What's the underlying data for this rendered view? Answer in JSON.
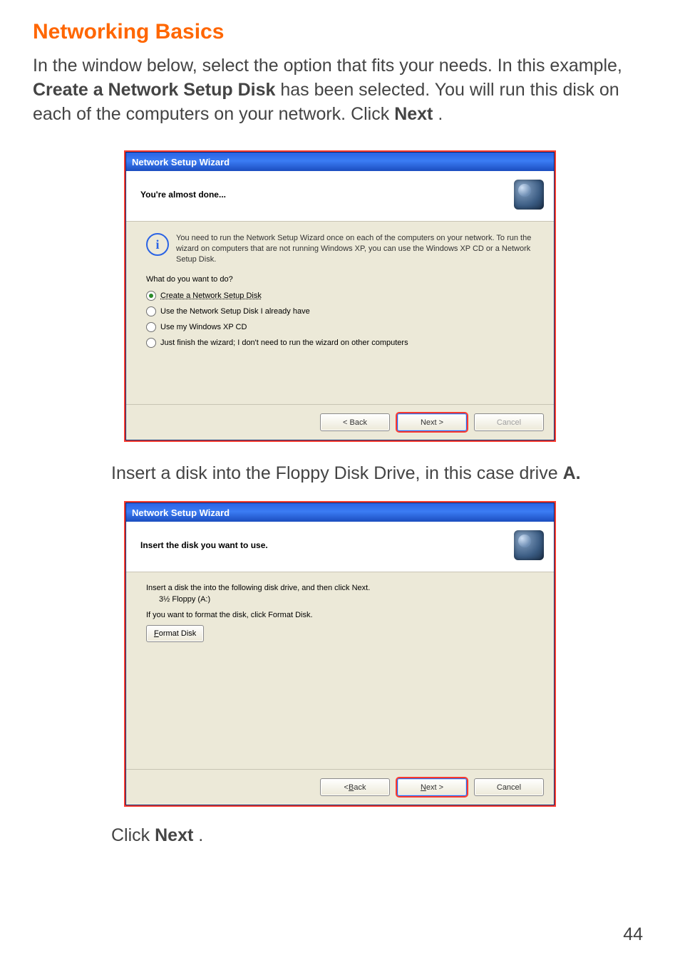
{
  "page": {
    "heading": "Networking Basics",
    "intro_prefix": "In the window below, select the option that fits your needs. In this example, ",
    "intro_bold1": "Create a Network Setup Disk",
    "intro_mid": " has been selected.  You will run this disk on each of the computers on your network. Click ",
    "intro_bold2": "Next",
    "intro_end": ".",
    "caption_prefix": "Insert a disk into the Floppy Disk Drive, in this case drive ",
    "caption_bold": "A.",
    "click_next_prefix": "Click ",
    "click_next_bold": "Next",
    "click_next_end": ".",
    "page_number": "44"
  },
  "dialog1": {
    "title": "Network Setup Wizard",
    "header_title": "You're almost done...",
    "info_icon_char": "i",
    "info_text": "You need to run the Network Setup Wizard once on each of the computers on your network. To run the wizard on computers that are not running Windows XP, you can use the Windows XP CD or a Network Setup Disk.",
    "prompt": "What do you want to do?",
    "options": [
      {
        "label": "Create a Network Setup Disk",
        "checked": true
      },
      {
        "label": "Use the Network Setup Disk I already have",
        "checked": false
      },
      {
        "label": "Use my Windows XP CD",
        "checked": false
      },
      {
        "label": "Just finish the wizard; I don't need to run the wizard on other computers",
        "checked": false
      }
    ],
    "buttons": {
      "back": "< Back",
      "next": "Next >",
      "cancel": "Cancel"
    }
  },
  "dialog2": {
    "title": "Network Setup Wizard",
    "header_title": "Insert the disk you want to use.",
    "line1": "Insert a disk the into the following disk drive, and then click Next.",
    "drive": "3½ Floppy (A:)",
    "line2": "If you want to format the disk, click Format Disk.",
    "format_btn_u": "F",
    "format_btn_rest": "ormat Disk",
    "buttons": {
      "back_u": "B",
      "back_rest": "ack",
      "next_u": "N",
      "next_rest": "ext >",
      "cancel": "Cancel"
    }
  }
}
